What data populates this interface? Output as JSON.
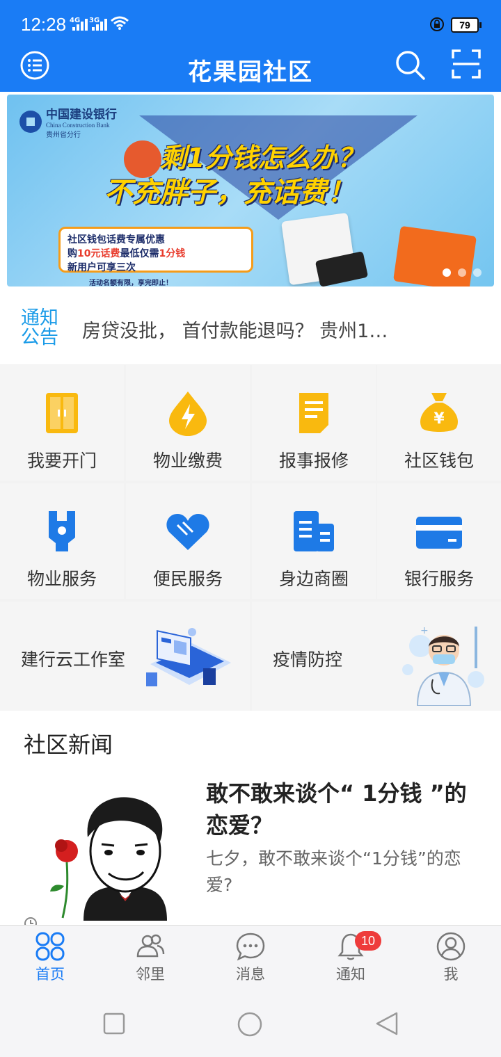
{
  "status": {
    "time": "12:28",
    "net1": "4G",
    "net2": "3G",
    "battery": "79"
  },
  "header": {
    "title": "花果园社区"
  },
  "banner": {
    "bank_cn": "中国建设银行",
    "bank_en": "China Construction Bank",
    "bank_branch": "贵州省分行",
    "headline1": "剩1分钱怎么办？",
    "headline2": "不充胖子，充话费！",
    "promo_line1": "社区钱包话费专属优惠",
    "promo_line2_a": "购",
    "promo_line2_hl": "10元话费",
    "promo_line2_b": "最低仅需",
    "promo_line2_hl2": "1分钱",
    "promo_line3": "新用户可享三次",
    "note": "活动名额有限，享完即止！"
  },
  "notice": {
    "tag": "通知公告",
    "text": "房贷没批， 首付款能退吗？ 贵州1…"
  },
  "grid": {
    "items": [
      {
        "label": "我要开门",
        "icon": "door-icon",
        "color": "#f9b90f"
      },
      {
        "label": "物业缴费",
        "icon": "drop-bolt-icon",
        "color": "#f9b90f"
      },
      {
        "label": "报事报修",
        "icon": "document-icon",
        "color": "#f9b90f"
      },
      {
        "label": "社区钱包",
        "icon": "money-bag-icon",
        "color": "#f9b90f"
      },
      {
        "label": "物业服务",
        "icon": "wrench-icon",
        "color": "#1e7ae6"
      },
      {
        "label": "便民服务",
        "icon": "heart-hands-icon",
        "color": "#1e7ae6"
      },
      {
        "label": "身边商圈",
        "icon": "store-list-icon",
        "color": "#1e7ae6"
      },
      {
        "label": "银行服务",
        "icon": "bank-card-icon",
        "color": "#1e7ae6"
      }
    ],
    "wide": [
      {
        "label": "建行云工作室"
      },
      {
        "label": "疫情防控"
      }
    ]
  },
  "news": {
    "heading": "社区新闻",
    "title": "敢不敢来谈个“ 1分钱 ”的恋爱？",
    "desc": "七夕，敢不敢来谈个“1分钱”的恋爱?"
  },
  "tabs": [
    {
      "label": "首页",
      "active": true
    },
    {
      "label": "邻里"
    },
    {
      "label": "消息"
    },
    {
      "label": "通知",
      "badge": "10"
    },
    {
      "label": "我"
    }
  ],
  "colors": {
    "brand": "#1a7cf5",
    "yellow": "#f9b90f",
    "blue_icon": "#1e7ae6",
    "badge": "#ee3b3b"
  }
}
